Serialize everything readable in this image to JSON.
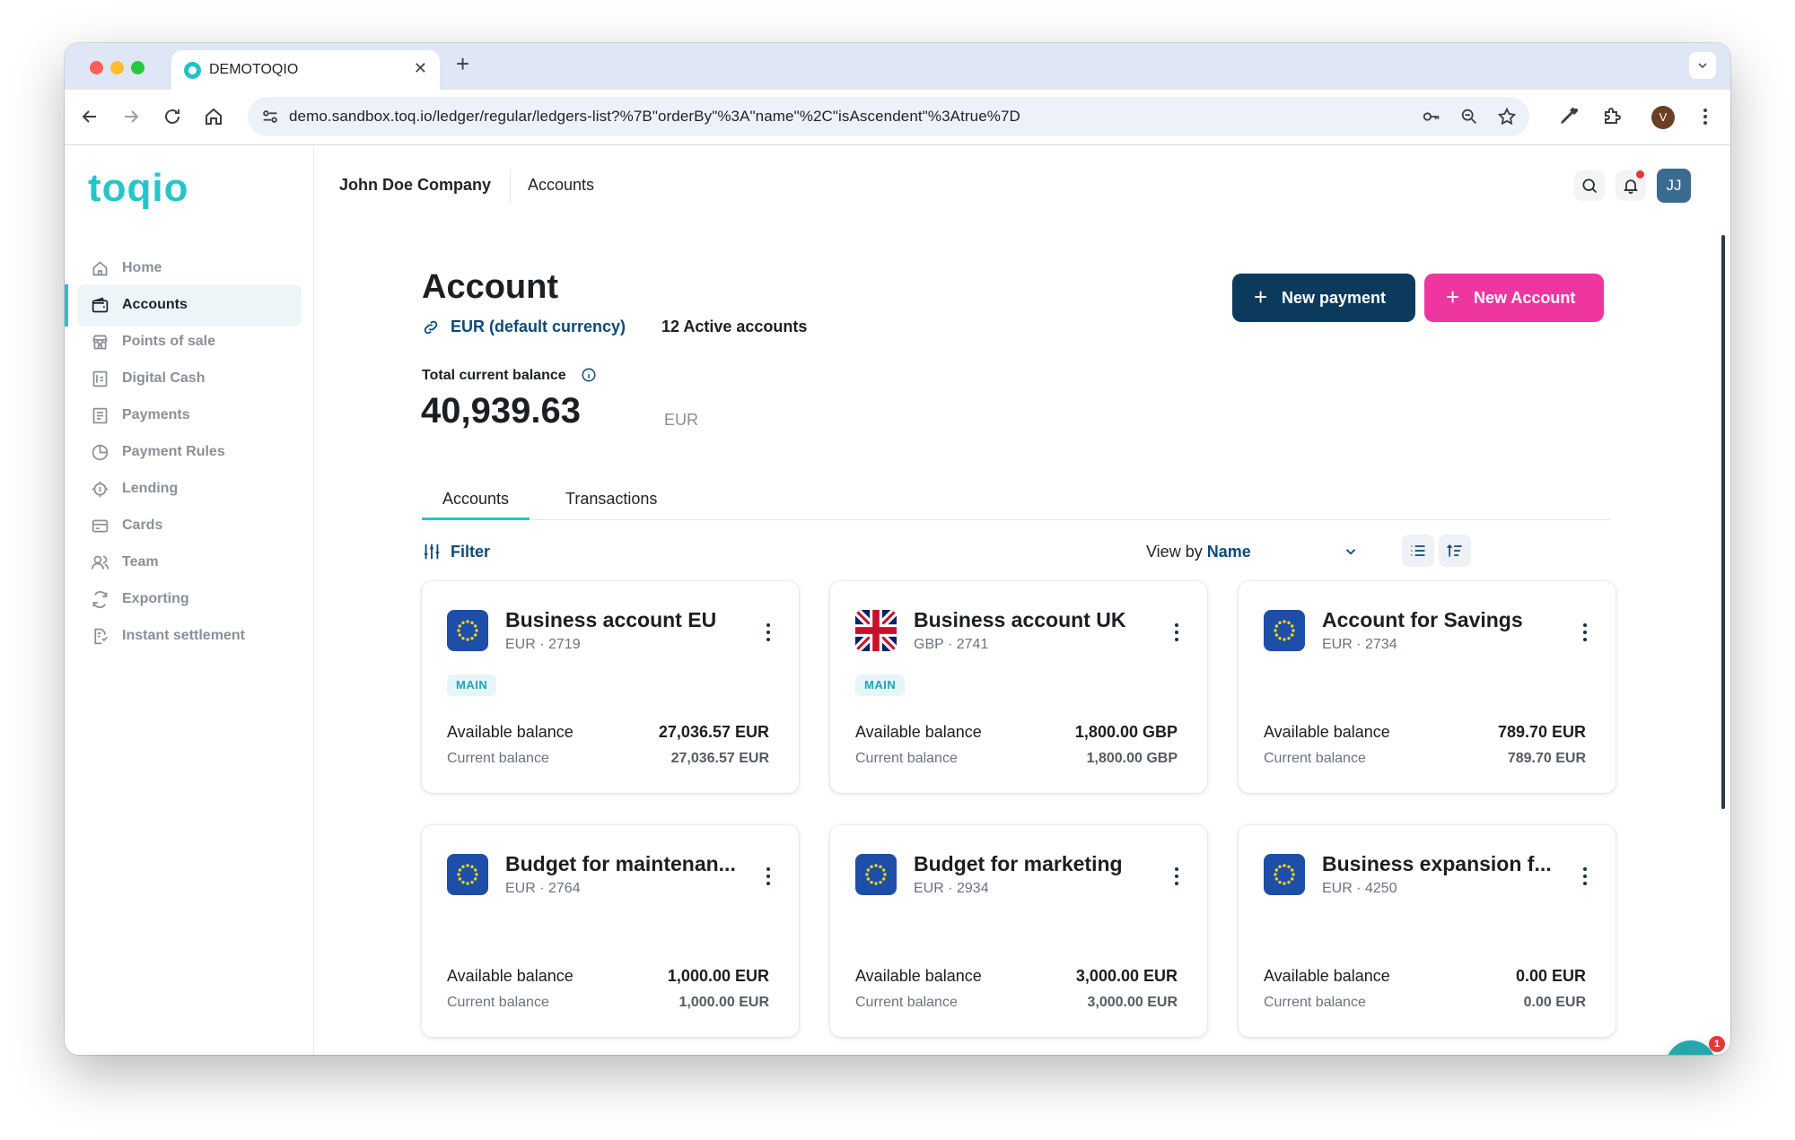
{
  "browser": {
    "tab_title": "DEMOTOQIO",
    "url": "demo.sandbox.toq.io/ledger/regular/ledgers-list?%7B\"orderBy\"%3A\"name\"%2C\"isAscendent\"%3Atrue%7D",
    "profile_initial": "V"
  },
  "app": {
    "logo_text": "toqio",
    "company": "John Doe Company",
    "breadcrumb": "Accounts",
    "avatar": "JJ"
  },
  "sidebar": {
    "items": [
      {
        "label": "Home",
        "icon": "home-icon"
      },
      {
        "label": "Accounts",
        "icon": "wallet-icon",
        "active": true
      },
      {
        "label": "Points of sale",
        "icon": "store-icon"
      },
      {
        "label": "Digital Cash",
        "icon": "digital-cash-icon"
      },
      {
        "label": "Payments",
        "icon": "payments-icon"
      },
      {
        "label": "Payment Rules",
        "icon": "pie-icon"
      },
      {
        "label": "Lending",
        "icon": "lending-icon"
      },
      {
        "label": "Cards",
        "icon": "card-icon"
      },
      {
        "label": "Team",
        "icon": "team-icon"
      },
      {
        "label": "Exporting",
        "icon": "refresh-icon"
      },
      {
        "label": "Instant settlement",
        "icon": "settlement-icon"
      }
    ]
  },
  "page": {
    "title": "Account",
    "currency_link": "EUR (default currency)",
    "active_accounts": "12 Active accounts",
    "total_label": "Total current balance",
    "total_value": "40,939.63",
    "total_currency": "EUR",
    "new_payment": "New payment",
    "new_account": "New Account",
    "tabs": [
      "Accounts",
      "Transactions"
    ],
    "filter": "Filter",
    "view_by_prefix": "View by",
    "view_by_value": "Name"
  },
  "cards": [
    {
      "name": "Business account EU",
      "sub": "EUR · 2719",
      "flag": "eu",
      "badge": "MAIN",
      "available_label": "Available balance",
      "available": "27,036.57 EUR",
      "current_label": "Current balance",
      "current": "27,036.57 EUR"
    },
    {
      "name": "Business account UK",
      "sub": "GBP · 2741",
      "flag": "uk",
      "badge": "MAIN",
      "available_label": "Available balance",
      "available": "1,800.00 GBP",
      "current_label": "Current balance",
      "current": "1,800.00 GBP"
    },
    {
      "name": "Account for Savings",
      "sub": "EUR · 2734",
      "flag": "eu",
      "badge": "",
      "available_label": "Available balance",
      "available": "789.70 EUR",
      "current_label": "Current balance",
      "current": "789.70 EUR"
    },
    {
      "name": "Budget for maintenan...",
      "sub": "EUR · 2764",
      "flag": "eu",
      "badge": "",
      "available_label": "Available balance",
      "available": "1,000.00 EUR",
      "current_label": "Current balance",
      "current": "1,000.00 EUR"
    },
    {
      "name": "Budget for marketing",
      "sub": "EUR · 2934",
      "flag": "eu",
      "badge": "",
      "available_label": "Available balance",
      "available": "3,000.00 EUR",
      "current_label": "Current balance",
      "current": "3,000.00 EUR"
    },
    {
      "name": "Business expansion f...",
      "sub": "EUR · 4250",
      "flag": "eu",
      "badge": "",
      "available_label": "Available balance",
      "available": "0.00 EUR",
      "current_label": "Current balance",
      "current": "0.00 EUR"
    }
  ],
  "chat": {
    "badge": "1"
  },
  "colors": {
    "brand_teal": "#26c5c9",
    "primary_navy": "#0b3a5c",
    "accent_pink": "#ee35a0"
  }
}
